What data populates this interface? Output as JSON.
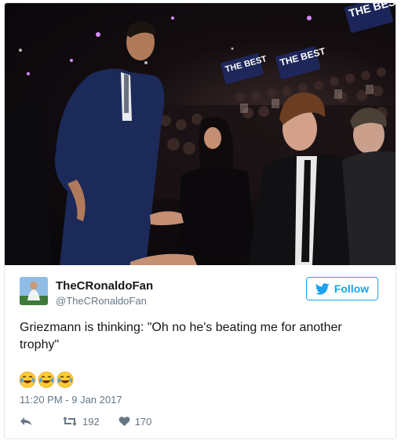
{
  "tweet": {
    "display_name": "TheCRonaldoFan",
    "handle": "@TheCRonaldoFan",
    "follow_label": "Follow",
    "text": "Griezmann is thinking: \"Oh no he's beating me for another trophy\"",
    "emojis": [
      "face-with-tears-of-joy",
      "face-with-tears-of-joy",
      "face-with-tears-of-joy"
    ],
    "timestamp": "11:20 PM - 9 Jan 2017",
    "retweet_count": "192",
    "like_count": "170"
  },
  "photo": {
    "signs": [
      "THE BEST",
      "THE BEST",
      "THE BEST"
    ]
  },
  "colors": {
    "accent": "#1da1f2",
    "muted": "#657786",
    "border": "#e1e8ed",
    "text": "#14171a"
  },
  "icons": {
    "follow": "twitter-bird-icon",
    "reply": "reply-icon",
    "retweet": "retweet-icon",
    "like": "heart-icon"
  }
}
